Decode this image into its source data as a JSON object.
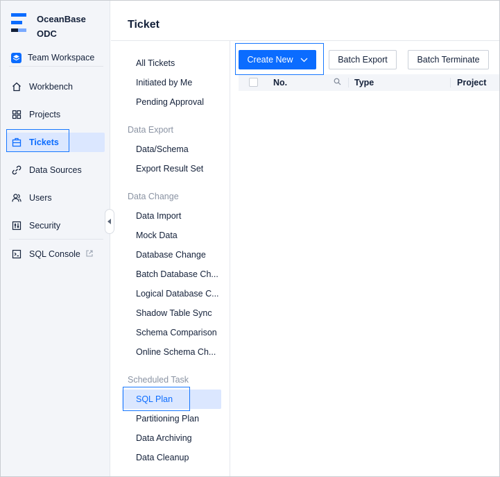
{
  "app": {
    "brand_line1": "OceanBase",
    "brand_line2": "ODC",
    "workspace": "Team Workspace"
  },
  "nav": {
    "items": [
      {
        "label": "Workbench",
        "icon": "home-icon"
      },
      {
        "label": "Projects",
        "icon": "grid-icon"
      },
      {
        "label": "Tickets",
        "icon": "ticket-icon",
        "active": true
      },
      {
        "label": "Data Sources",
        "icon": "link-icon"
      },
      {
        "label": "Users",
        "icon": "users-icon"
      },
      {
        "label": "Security",
        "icon": "sliders-icon"
      },
      {
        "label": "SQL Console",
        "icon": "terminal-icon"
      }
    ]
  },
  "page": {
    "title": "Ticket"
  },
  "submenu": {
    "top_items": [
      "All Tickets",
      "Initiated by Me",
      "Pending Approval"
    ],
    "groups": [
      {
        "title": "Data Export",
        "items": [
          "Data/Schema",
          "Export Result Set"
        ]
      },
      {
        "title": "Data Change",
        "items": [
          "Data Import",
          "Mock Data",
          "Database Change",
          "Batch Database Ch...",
          "Logical Database C...",
          "Shadow Table Sync",
          "Schema Comparison",
          "Online Schema Ch..."
        ]
      },
      {
        "title": "Scheduled Task",
        "items": [
          "SQL Plan",
          "Partitioning Plan",
          "Data Archiving",
          "Data Cleanup"
        ]
      }
    ],
    "active_item": "SQL Plan"
  },
  "toolbar": {
    "create_label": "Create New",
    "batch_export_label": "Batch Export",
    "batch_terminate_label": "Batch Terminate"
  },
  "table": {
    "columns": [
      "No.",
      "Type",
      "Project"
    ]
  },
  "colors": {
    "accent": "#0b6cff",
    "highlight_border": "#1677ff",
    "sidebar_bg": "#f3f5f9",
    "active_bg": "#dbe7ff"
  }
}
